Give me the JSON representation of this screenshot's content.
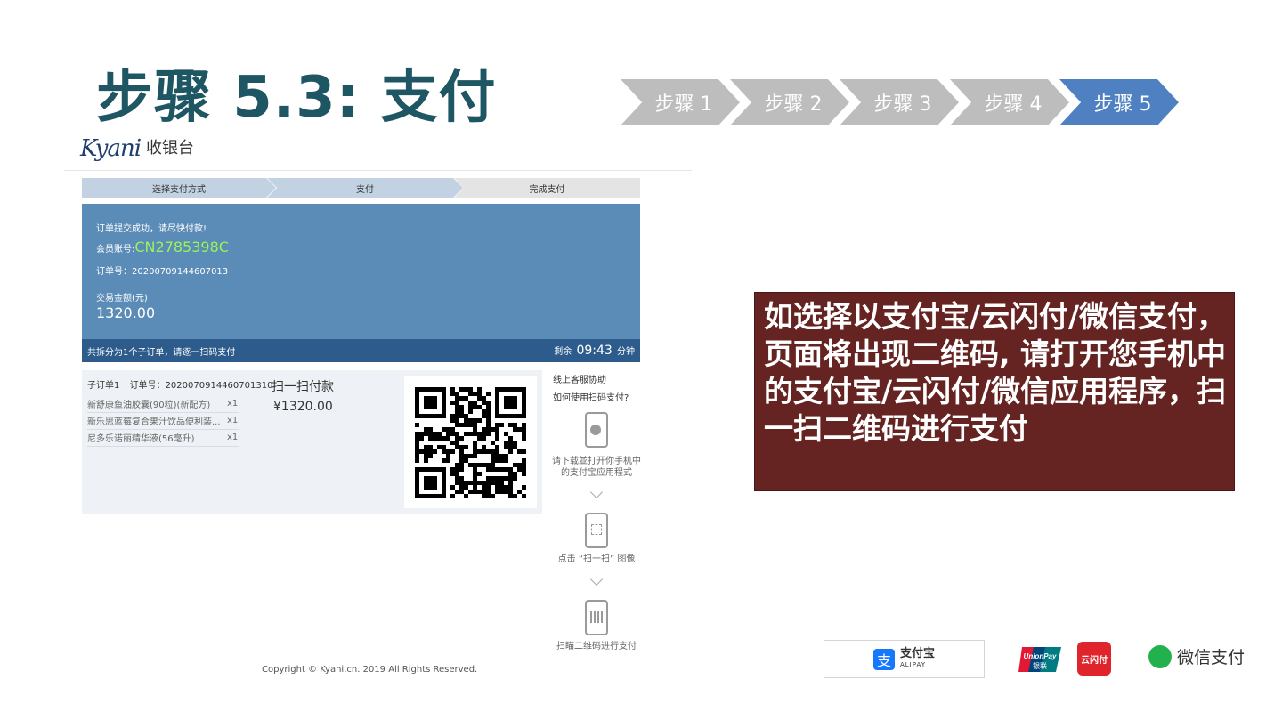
{
  "slide": {
    "title": "步骤 5.3: 支付"
  },
  "steps": [
    "步骤 1",
    "步骤 2",
    "步骤 3",
    "步骤 4",
    "步骤 5"
  ],
  "cashier": {
    "brand_logo": "Kyani",
    "brand_name": "收银台",
    "progress": [
      "选择支付方式",
      "支付",
      "完成支付"
    ],
    "order": {
      "success_msg": "订单提交成功，请尽快付款!",
      "member_label": "会员账号:",
      "member_id": "CN2785398C",
      "order_no_label": "订单号：",
      "order_no": "20200709144607013",
      "amount_label": "交易金额(元)",
      "amount": "1320.00",
      "split_note": "共拆分为1个子订单，请逐一扫码支付",
      "remaining_label": "剩余",
      "timer": "09:43",
      "timer_unit": "分钟"
    },
    "suborder": {
      "label": "子订单1",
      "order_no_label": "订单号：",
      "order_no": "2020070914460701310",
      "scan_title": "扫一扫付款",
      "amount": "¥1320.00",
      "items": [
        {
          "name": "新舒康鱼油胶囊(90粒)(新配方)",
          "qty": "x1"
        },
        {
          "name": "新乐思蓝莓复合果汁饮品便利装...",
          "qty": "x1"
        },
        {
          "name": "尼多乐诺丽精华液(56毫升)",
          "qty": "x1"
        }
      ]
    },
    "help": {
      "online_support": "线上客服协助",
      "how_to": "如何使用扫码支付?",
      "step1": "请下载並打开你手机中的支付宝应用程式",
      "step2": "点击 “扫一扫” 图像",
      "step3": "扫瞄二维码进行支付"
    },
    "copyright": "Copyright © Kyani.cn. 2019 All Rights Reserved."
  },
  "note": {
    "text": "如选择以支付宝/云闪付/微信支付，页面将出现二维码, 请打开您手机中的支付宝/云闪付/微信应用程序，扫一扫二维码进行支付"
  },
  "payment_logos": {
    "alipay": "支付宝",
    "alipay_en": "ALIPAY",
    "unionpay": "UnionPay",
    "unionpay_cn": "银联",
    "quickpass": "云闪付",
    "wechat": "微信支付"
  },
  "colors": {
    "title": "#1f5663",
    "step_active": "#4f80c2",
    "step_inactive": "#bdbdbd",
    "order_panel": "#5b8bb7",
    "order_footer": "#2d5c8c",
    "member_id": "#9cf25a",
    "note_bg": "#652321"
  }
}
